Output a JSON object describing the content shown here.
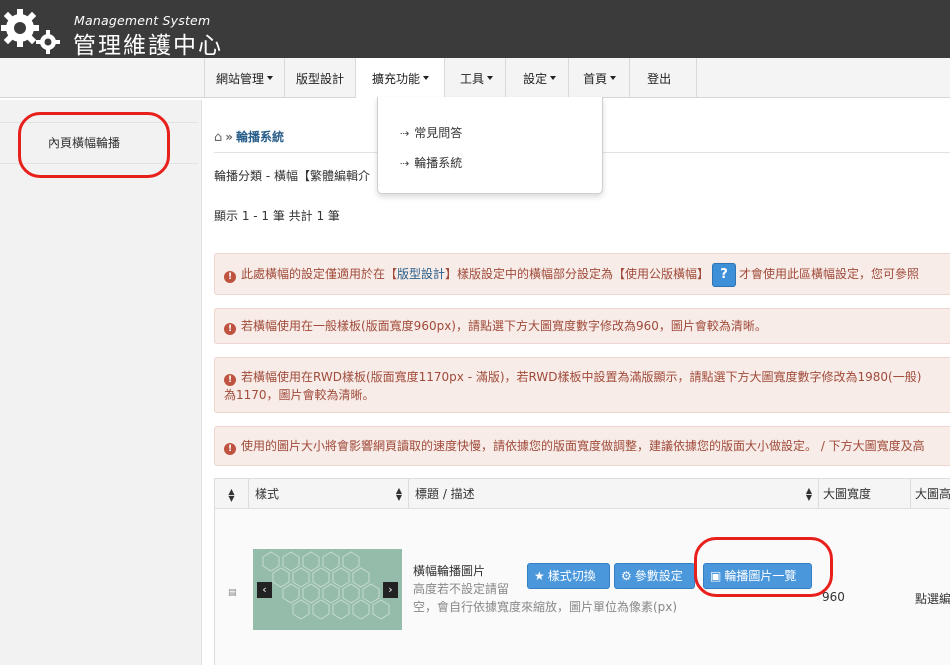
{
  "header": {
    "subtitle": "Management System",
    "title": "管理維護中心"
  },
  "nav": {
    "items": [
      {
        "label": "網站管理",
        "has_caret": true
      },
      {
        "label": "版型設計",
        "has_caret": false
      },
      {
        "label": "擴充功能",
        "has_caret": true,
        "active": true
      },
      {
        "label": "工具",
        "has_caret": true
      },
      {
        "label": "設定",
        "has_caret": true
      },
      {
        "label": "首頁",
        "has_caret": true
      },
      {
        "label": "登出",
        "has_caret": false
      }
    ],
    "dropdown": [
      {
        "label": "常見問答"
      },
      {
        "label": "輪播系統"
      }
    ]
  },
  "sidebar": {
    "items": [
      {
        "label": "內頁橫幅輪播"
      }
    ]
  },
  "main": {
    "breadcrumb": {
      "current": "輪播系統"
    },
    "category": "輪播分類 - 橫幅【繁體編輯介",
    "count": "顯示 1 - 1 筆 共計 1 筆",
    "alerts": [
      {
        "pre": "此處橫幅的設定僅適用於在【",
        "link": "版型設計",
        "mid": "】樣版設定中的橫幅部分設定為【使用公版橫幅】",
        "post": "才會使用此區橫幅設定，您可參照"
      },
      {
        "text": "若橫幅使用在一般樣板(版面寬度960px)，請點選下方大圖寬度數字修改為960，圖片會較為清晰。"
      },
      {
        "line1": "若橫幅使用在RWD樣板(版面寬度1170px - 滿版)，若RWD樣板中設置為滿版顯示，請點選下方大圖寬度數字修改為1980(一般)",
        "line2": "為1170，圖片會較為清晰。"
      },
      {
        "text": "使用的圖片大小將會影響網頁讀取的速度快慢，請依據您的版面寬度做調整，建議依據您的版面大小做設定。 / 下方大圖寬度及高"
      }
    ],
    "table": {
      "headers": [
        "樣式",
        "標題 / 描述",
        "大圖寬度",
        "大圖高"
      ],
      "row": {
        "title": "橫幅輪播圖片",
        "description_1": "高度若不設定請留",
        "description_2": "空，會自行依據寬度來縮放，圖片單位為像素(px)",
        "buttons": {
          "style": "樣式切換",
          "params": "參數設定",
          "images": "輪播圖片一覽"
        },
        "width": "960",
        "height": "點選編"
      }
    }
  },
  "colors": {
    "topbar": "#3b3b3b",
    "link": "#2a5e8a",
    "alert_text": "#a14b3a",
    "alert_bg": "#f7ece8",
    "button": "#4a97dc",
    "annotation": "#e8201c"
  }
}
